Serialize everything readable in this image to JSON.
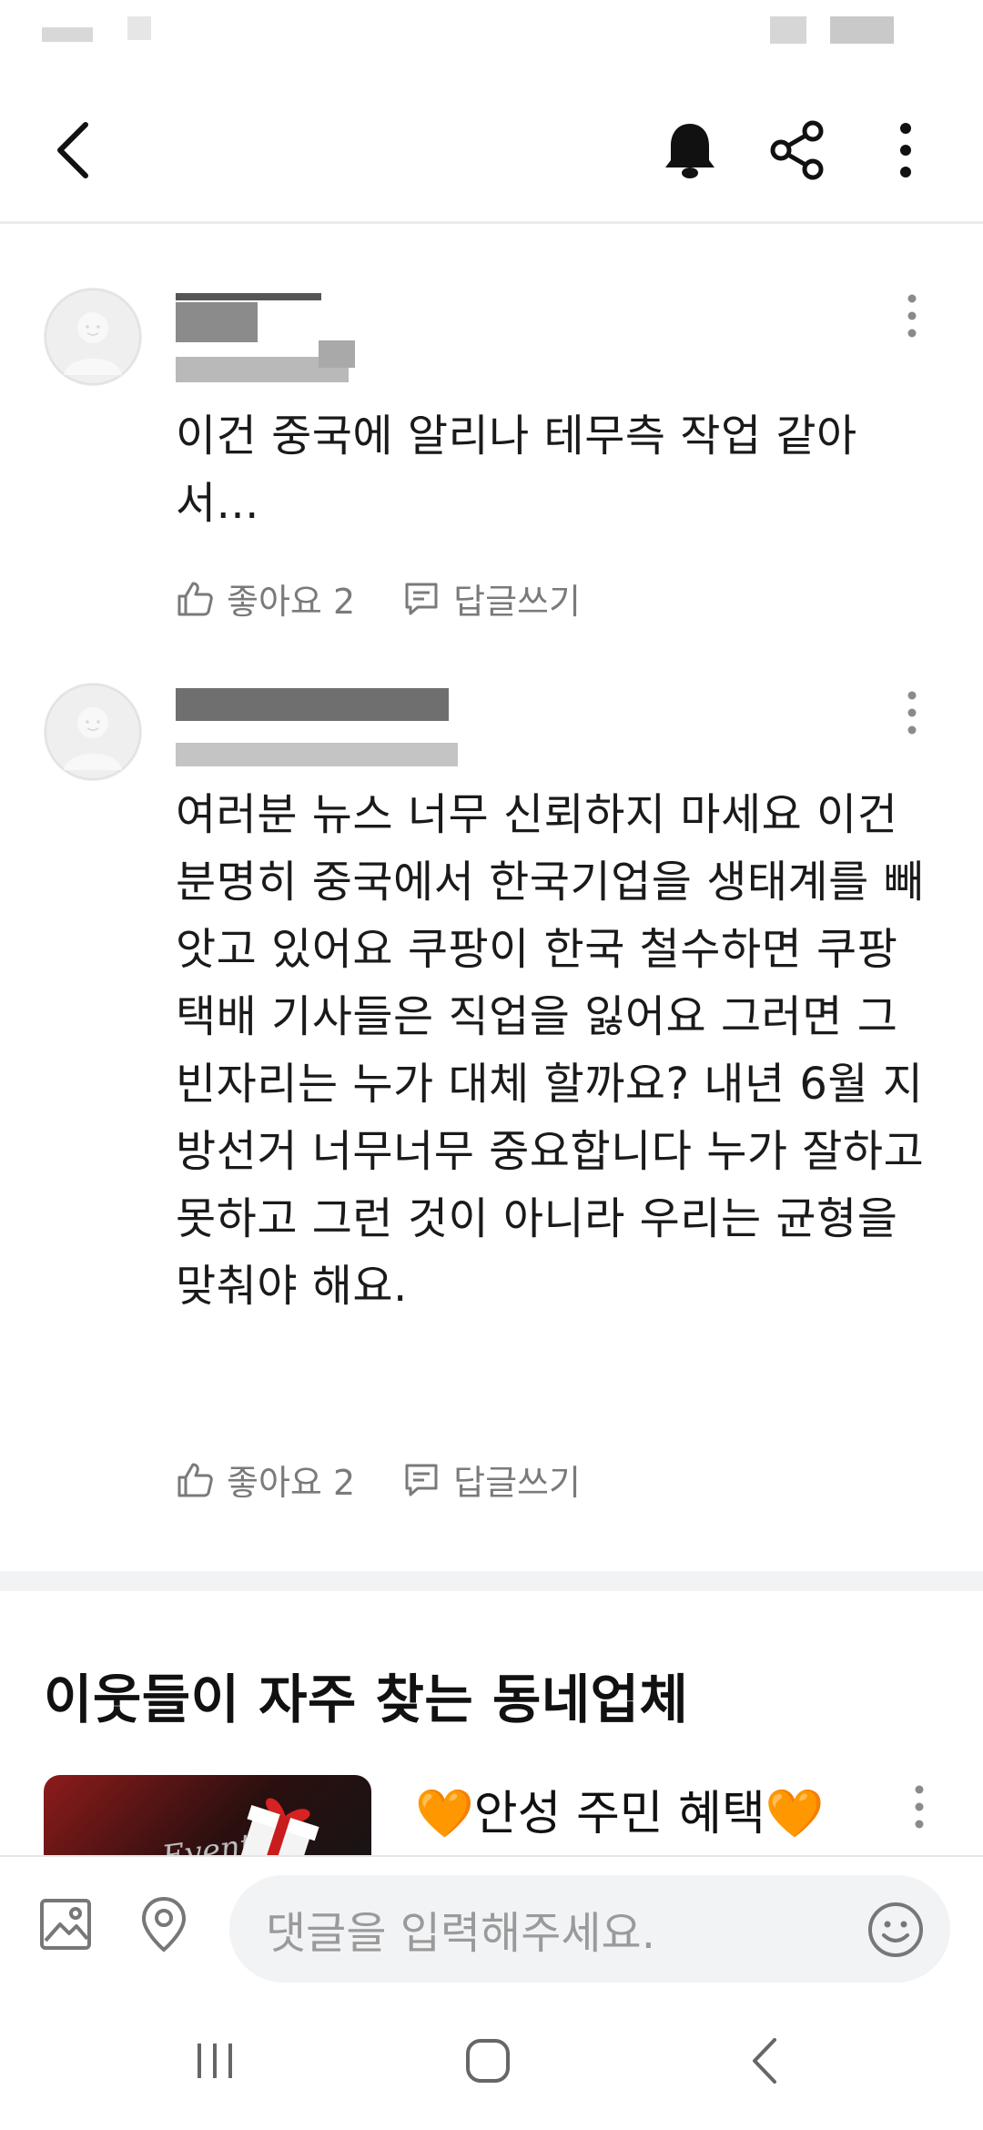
{
  "comments": [
    {
      "text": "이건 중국에 알리나 테무측 작업 같아서...",
      "like_label": "좋아요 2",
      "reply_label": "답글쓰기"
    },
    {
      "text": "여러분 뉴스 너무 신뢰하지 마세요 이건 분명히 중국에서 한국기업을 생태계를 빼앗고 있어요 쿠팡이 한국 철수하면 쿠팡 택배 기사들은 직업을 잃어요 그러면 그 빈자리는 누가 대체 할까요? 내년 6월 지방선거 너무너무 중요합니다 누가 잘하고 못하고 그런 것이 아니라 우리는 균형을 맞춰야 해요.",
      "like_label": "좋아요 2",
      "reply_label": "답글쓰기"
    }
  ],
  "section": {
    "title": "이웃들이 자주 찾는 동네업체"
  },
  "business": {
    "title": "🧡안성 주민 혜택🧡",
    "thumb_text": "Event"
  },
  "input": {
    "placeholder": "댓글을 입력해주세요."
  },
  "colors": {
    "divider": "#ececec",
    "secondary_text": "#7a7a7a",
    "input_bg": "#f2f3f5"
  }
}
